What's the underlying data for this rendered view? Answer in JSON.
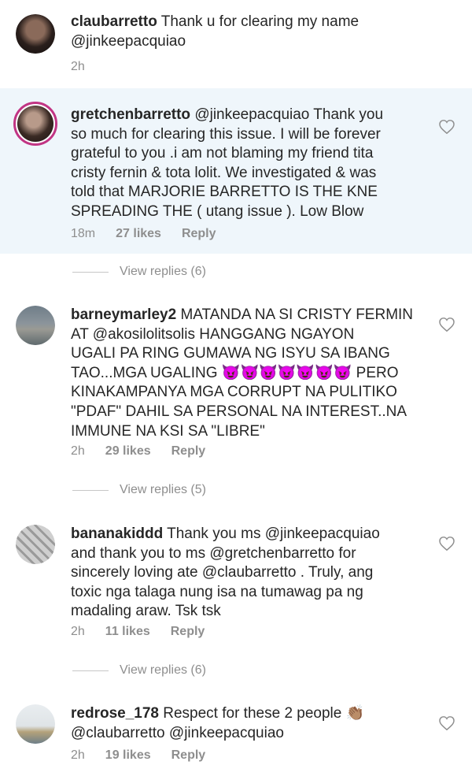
{
  "comments": [
    {
      "username": "claubarretto",
      "text": "Thank u for clearing my name\n@jinkeepacquiao",
      "time": "2h",
      "likes": "",
      "reply": ""
    },
    {
      "username": "gretchenbarretto",
      "text": "@jinkeepacquiao Thank you\nso much for clearing this issue. I will be forever\ngrateful to you .i am not blaming my friend tita\ncristy fernin & tota lolit. We investigated & was\ntold that MARJORIE BARRETTO IS THE KNE\nSPREADING THE ( utang issue ). Low Blow",
      "time": "18m",
      "likes": "27 likes",
      "reply": "Reply",
      "view_replies": "View replies (6)"
    },
    {
      "username": "barneymarley2",
      "text": "MATANDA NA SI CRISTY FERMIN\nAT @akosilolitsolis HANGGANG NGAYON\nUGALI PA RING GUMAWA NG ISYU SA IBANG\nTAO...MGA UGALING 😈😈😈😈😈😈😈 PERO\nKINAKAMPANYA MGA CORRUPT NA PULITIKO\n\"PDAF\" DAHIL SA PERSONAL NA INTEREST..NA\nIMMUNE NA KSI SA \"LIBRE\"",
      "time": "2h",
      "likes": "29 likes",
      "reply": "Reply",
      "view_replies": "View replies (5)"
    },
    {
      "username": "bananakiddd",
      "text": "Thank you ms @jinkeepacquiao\nand thank you to ms @gretchenbarretto for\nsincerely loving ate @claubarretto . Truly, ang\ntoxic nga talaga nung isa na tumawag pa ng\nmadaling araw. Tsk tsk",
      "time": "2h",
      "likes": "11 likes",
      "reply": "Reply",
      "view_replies": "View replies (6)"
    },
    {
      "username": "redrose_178",
      "text": "Respect for these 2 people 👏🏽\n@claubarretto @jinkeepacquiao",
      "time": "2h",
      "likes": "19 likes",
      "reply": "Reply"
    }
  ],
  "colors": {
    "highlight_bg": "#eff6fb",
    "text": "#262626",
    "meta": "#8e8e8e"
  }
}
